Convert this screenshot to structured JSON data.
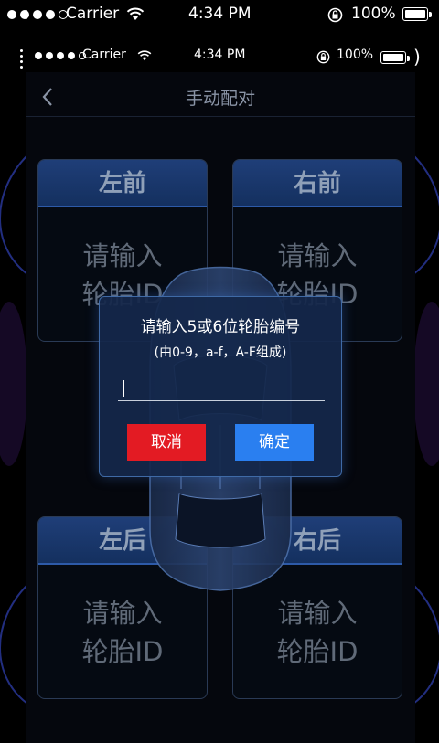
{
  "status_bar": {
    "carrier": "Carrier",
    "time": "4:34 PM",
    "battery": "100%",
    "icons": [
      "signal-dots",
      "wifi-icon",
      "rotation-lock-icon",
      "battery-icon"
    ]
  },
  "nav": {
    "back_icon": "chevron-left-icon",
    "title": "手动配对"
  },
  "tires": {
    "front_left": {
      "label": "左前",
      "placeholder_line1": "请输入",
      "placeholder_line2": "轮胎ID"
    },
    "front_right": {
      "label": "右前",
      "placeholder_line1": "请输入",
      "placeholder_line2": "轮胎ID"
    },
    "rear_left": {
      "label": "左后",
      "placeholder_line1": "请输入",
      "placeholder_line2": "轮胎ID"
    },
    "rear_right": {
      "label": "右后",
      "placeholder_line1": "请输入",
      "placeholder_line2": "轮胎ID"
    }
  },
  "dialog": {
    "title": "请输入5或6位轮胎编号",
    "subtitle": "(由0-9，a-f，A-F组成)",
    "input_value": "",
    "cancel_label": "取消",
    "confirm_label": "确定"
  },
  "colors": {
    "cancel": "#e31b23",
    "confirm": "#2a7ff0",
    "card_header": "#1f3e78",
    "dialog_bg": "#14284b"
  }
}
